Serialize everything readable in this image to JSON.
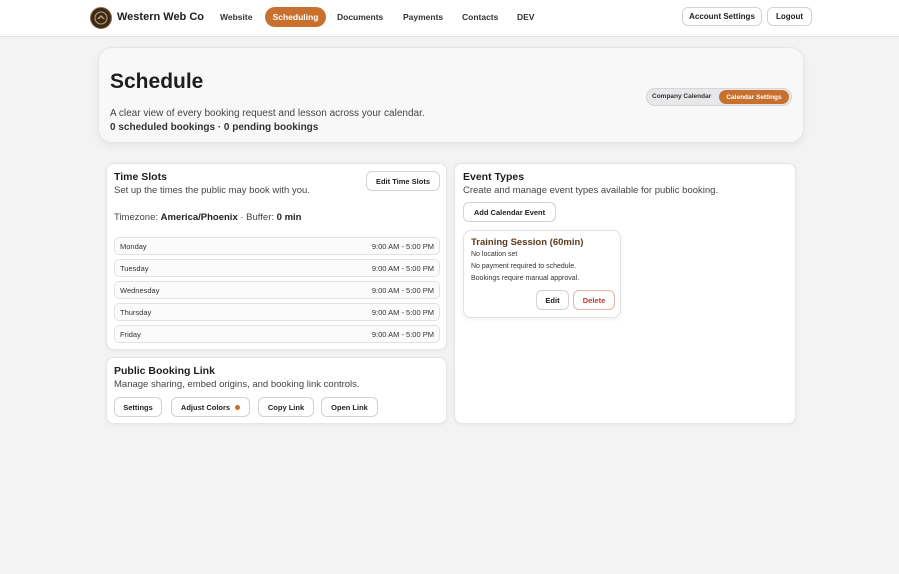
{
  "header": {
    "brand": "Western Web Co",
    "nav": [
      "Website",
      "Scheduling",
      "Documents",
      "Payments",
      "Contacts",
      "DEV"
    ],
    "active_nav": "Scheduling",
    "account_settings": "Account Settings",
    "logout": "Logout"
  },
  "hero": {
    "title": "Schedule",
    "subtitle": "A clear view of every booking request and lesson across your calendar.",
    "counts": "0 scheduled bookings · 0 pending bookings",
    "toggle": {
      "company_calendar": "Company Calendar",
      "calendar_settings": "Calendar Settings",
      "selected": "Calendar Settings"
    }
  },
  "time_slots": {
    "title": "Time Slots",
    "subtitle": "Set up the times the public may book with you.",
    "edit_button": "Edit Time Slots",
    "timezone_label": "Timezone:",
    "timezone": "America/Phoenix",
    "buffer_label": "· Buffer:",
    "buffer": "0 min",
    "slots": [
      {
        "day": "Monday",
        "time": "9:00 AM - 5:00 PM"
      },
      {
        "day": "Tuesday",
        "time": "9:00 AM - 5:00 PM"
      },
      {
        "day": "Wednesday",
        "time": "9:00 AM - 5:00 PM"
      },
      {
        "day": "Thursday",
        "time": "9:00 AM - 5:00 PM"
      },
      {
        "day": "Friday",
        "time": "9:00 AM - 5:00 PM"
      }
    ]
  },
  "booking_link": {
    "title": "Public Booking Link",
    "subtitle": "Manage sharing, embed origins, and booking link controls.",
    "buttons": {
      "settings": "Settings",
      "adjust_colors": "Adjust Colors",
      "copy_link": "Copy Link",
      "open_link": "Open Link"
    }
  },
  "event_types": {
    "title": "Event Types",
    "subtitle": "Create and manage event types available for public booking.",
    "add_button": "Add Calendar Event",
    "events": [
      {
        "name": "Training Session (60min)",
        "details": [
          "No location set",
          "No payment required to schedule.",
          "Bookings require manual approval."
        ],
        "edit": "Edit",
        "delete": "Delete"
      }
    ]
  },
  "colors": {
    "accent": "#c8712f",
    "delete": "#c0392b",
    "background": "#f3f3f4"
  }
}
